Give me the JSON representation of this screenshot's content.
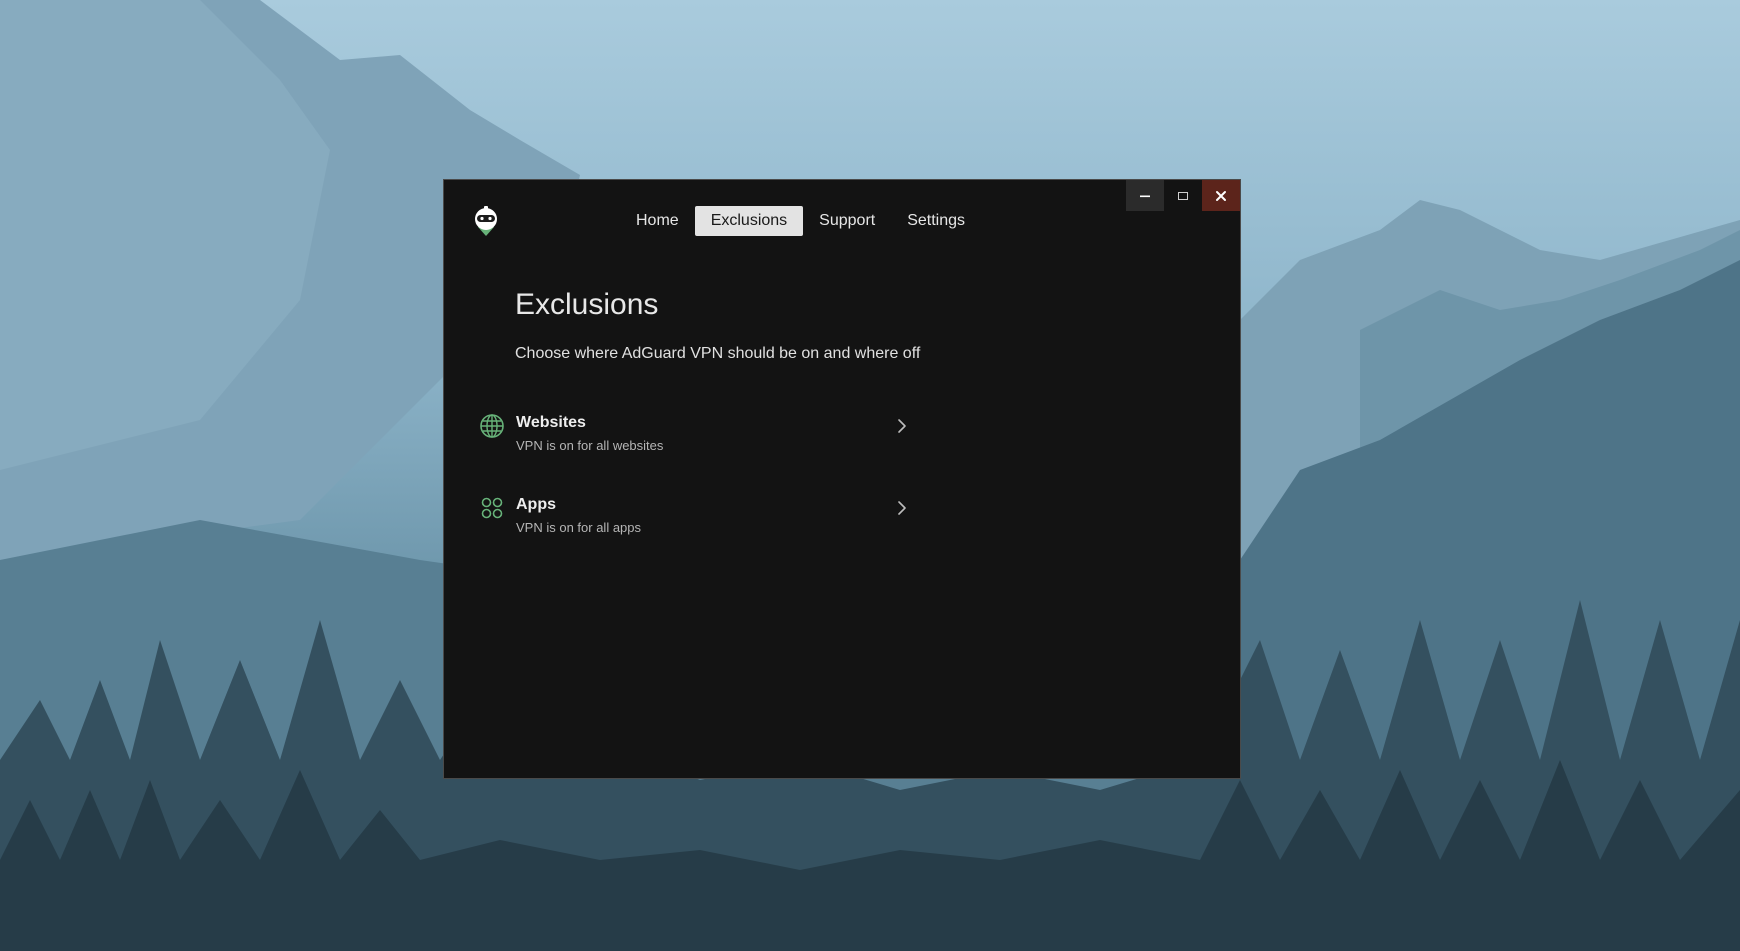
{
  "window": {
    "controls": {
      "minimize_icon": "minimize-icon",
      "maximize_icon": "maximize-icon",
      "close_icon": "close-icon"
    }
  },
  "app": {
    "logo_icon": "adguard-robot-logo-icon"
  },
  "nav": {
    "tabs": [
      {
        "label": "Home",
        "active": false
      },
      {
        "label": "Exclusions",
        "active": true
      },
      {
        "label": "Support",
        "active": false
      },
      {
        "label": "Settings",
        "active": false
      }
    ]
  },
  "page": {
    "title": "Exclusions",
    "subtitle": "Choose where AdGuard VPN should be on and where off"
  },
  "exclusions": [
    {
      "icon": "globe-icon",
      "title": "Websites",
      "description": "VPN is on for all websites"
    },
    {
      "icon": "apps-grid-icon",
      "title": "Apps",
      "description": "VPN is on for all apps"
    }
  ],
  "colors": {
    "window_bg": "#131313",
    "accent_green": "#67b279",
    "close_button_bg": "#5c241b",
    "active_tab_bg": "#e3e3e3"
  }
}
